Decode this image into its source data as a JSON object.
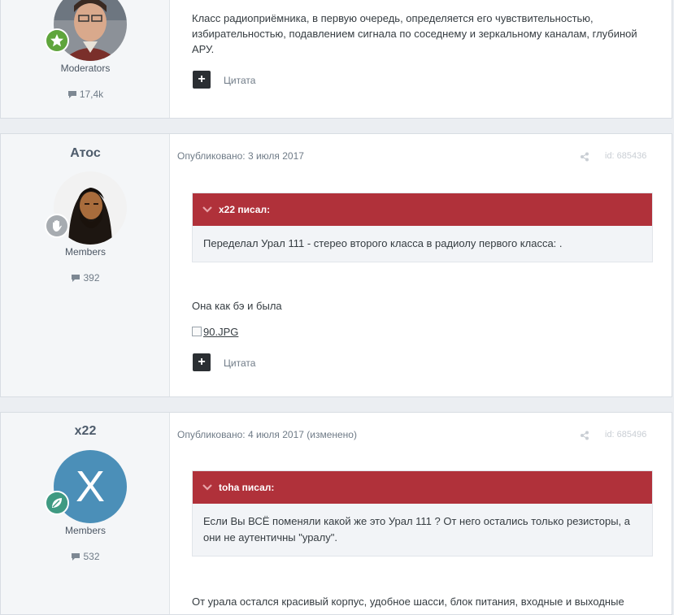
{
  "posts": [
    {
      "group": "Moderators",
      "post_count": "17,4k",
      "content_lines": [
        "Класс радиоприёмника, в первую очередь, определяется его чувствительностью,",
        "избирательностью, подавлением сигнала по соседнему и зеркальному каналам, глубиной",
        "АРУ."
      ],
      "quote_action": "Цитата",
      "badge_color": "#5fa53c"
    },
    {
      "author": "Атос",
      "group": "Members",
      "post_count": "392",
      "published": "Опубликовано: 3 июля 2017",
      "post_id": "id: 685436",
      "quote": {
        "header": "x22 писал:",
        "text": "Переделал Урал 111 - стерео второго класса в радиолу первого класса: ."
      },
      "reply": "Она как бэ и была",
      "image_link": "90.JPG",
      "quote_action": "Цитата",
      "badge_color": "#a7acb1"
    },
    {
      "author": "x22",
      "avatar_letter": "X",
      "avatar_color": "#4b8fb8",
      "group": "Members",
      "post_count": "532",
      "published": "Опубликовано: 4 июля 2017 (изменено)",
      "post_id": "id: 685496",
      "quote": {
        "header": "toha писал:",
        "text": "Если Вы ВСЁ поменяли какой же это Урал 111 ? От него остались только резисторы, а они не аутентичны \"уралу\"."
      },
      "reply": "От урала остался красивый корпус, удобное шасси, блок питания, входные и выходные",
      "badge_color": "#3f9a82"
    }
  ],
  "colors": {
    "quote_header": "#b0313a",
    "page_bg": "#ebeef2"
  }
}
